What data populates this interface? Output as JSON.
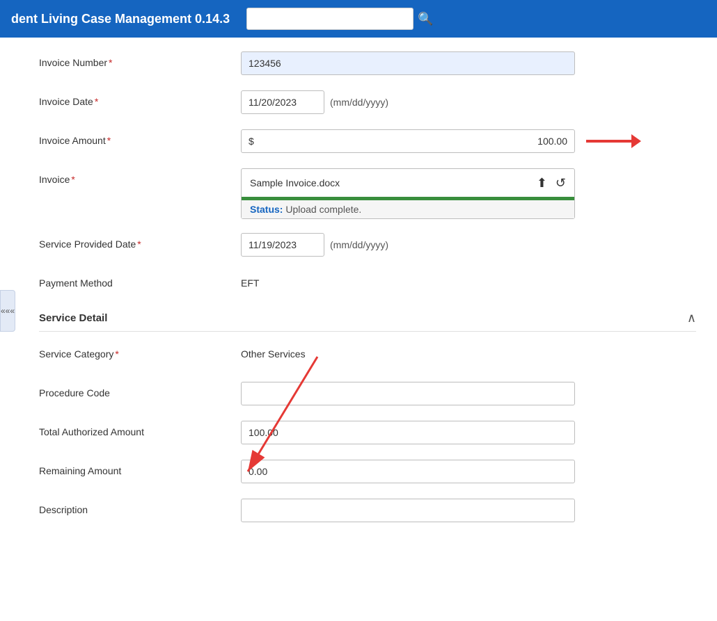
{
  "app": {
    "title": "dent Living Case Management 0.14.3",
    "search_placeholder": ""
  },
  "form": {
    "invoice_number_label": "Invoice Number",
    "invoice_number_value": "123456",
    "invoice_date_label": "Invoice Date",
    "invoice_date_value": "11/20/2023",
    "invoice_date_format": "(mm/dd/yyyy)",
    "invoice_amount_label": "Invoice Amount",
    "invoice_amount_currency": "$",
    "invoice_amount_value": "100.00",
    "invoice_label": "Invoice",
    "invoice_filename": "Sample Invoice.docx",
    "invoice_status_label": "Status:",
    "invoice_status_text": " Upload complete.",
    "service_provided_date_label": "Service Provided Date",
    "service_provided_date_value": "11/19/2023",
    "service_provided_date_format": "(mm/dd/yyyy)",
    "payment_method_label": "Payment Method",
    "payment_method_value": "EFT",
    "service_detail_section_label": "Service Detail",
    "service_category_label": "Service Category",
    "service_category_value": "Other Services",
    "procedure_code_label": "Procedure Code",
    "procedure_code_value": "",
    "total_authorized_amount_label": "Total Authorized Amount",
    "total_authorized_amount_value": "100.00",
    "remaining_amount_label": "Remaining Amount",
    "remaining_amount_value": "0.00",
    "description_label": "Description"
  },
  "icons": {
    "search": "🔍",
    "upload": "⬆",
    "undo": "↺",
    "chevron_up": "∧",
    "sidebar_toggle": "«««"
  }
}
